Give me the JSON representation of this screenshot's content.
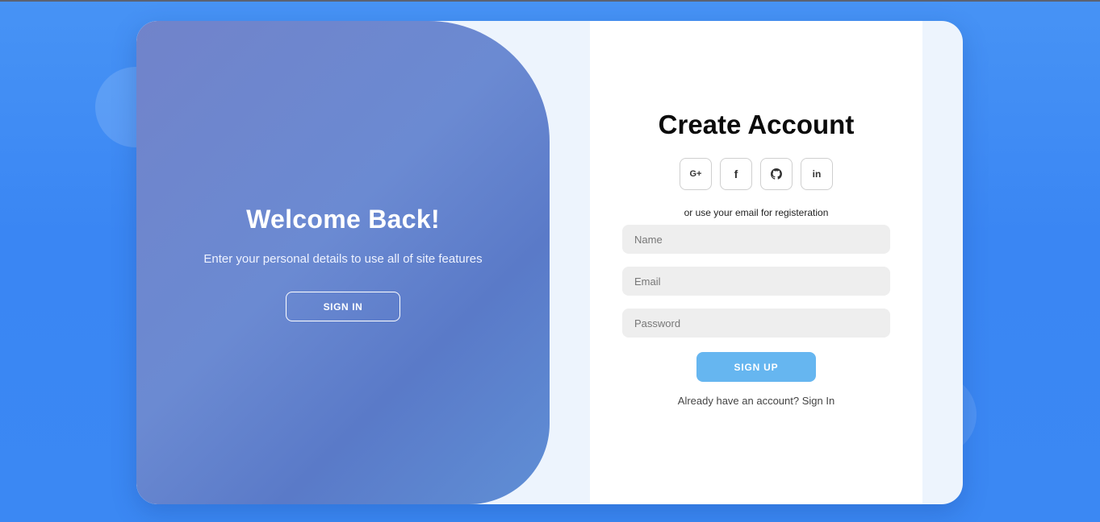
{
  "welcome": {
    "title": "Welcome Back!",
    "text": "Enter your personal details to use all of site features",
    "signin_label": "SIGN IN"
  },
  "form": {
    "title": "Create Account",
    "socials": [
      {
        "label": "G+",
        "icon": "google-plus-icon"
      },
      {
        "label": "f",
        "icon": "facebook-icon"
      },
      {
        "label": "github",
        "icon": "github-icon"
      },
      {
        "label": "in",
        "icon": "linkedin-icon"
      }
    ],
    "or_text": "or use your email for registeration",
    "name_placeholder": "Name",
    "email_placeholder": "Email",
    "password_placeholder": "Password",
    "signup_label": "SIGN UP",
    "already_text": "Already have an account?",
    "signin_link": "Sign In"
  },
  "colors": {
    "background": "#3b88f3",
    "overlay_start": "#7183ca",
    "overlay_end": "#5f8fd6",
    "signup_button": "#66b6f0",
    "input_bg": "#eeeeee"
  }
}
